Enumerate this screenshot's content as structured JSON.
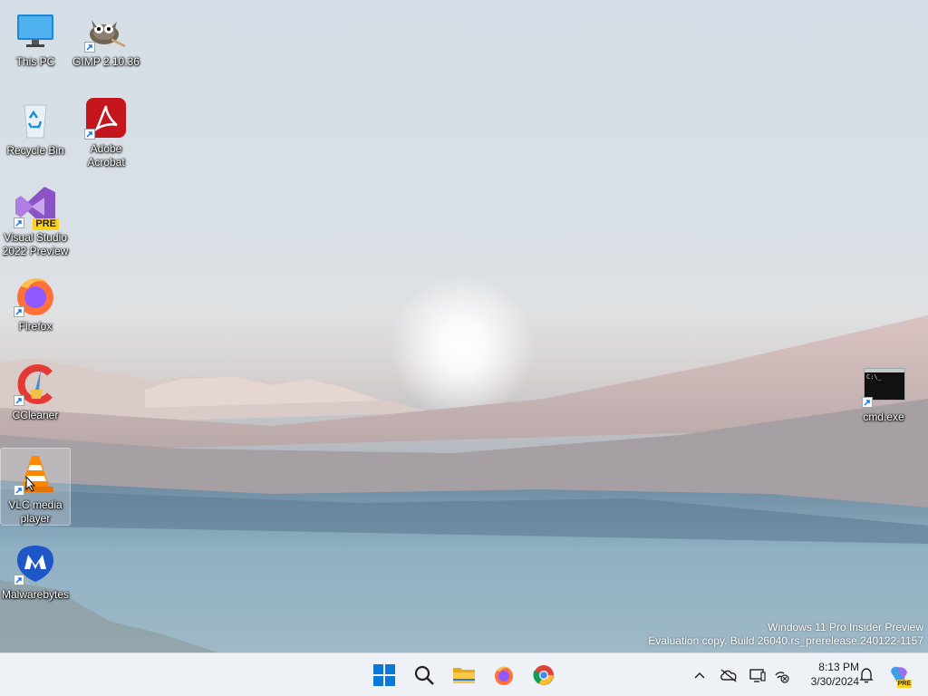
{
  "desktop_icons": [
    {
      "name": "this-pc",
      "label": "This PC",
      "icon": "monitor-icon"
    },
    {
      "name": "gimp",
      "label": "GIMP 2.10.36",
      "icon": "gimp-icon"
    },
    {
      "name": "recycle-bin",
      "label": "Recycle Bin",
      "icon": "recycle-bin-icon"
    },
    {
      "name": "adobe-acrobat",
      "label": "Adobe Acrobat",
      "icon": "acrobat-icon"
    },
    {
      "name": "visual-studio",
      "label": "Visual Studio 2022 Preview",
      "icon": "visual-studio-icon",
      "badge": "PRE"
    },
    {
      "name": "firefox",
      "label": "Firefox",
      "icon": "firefox-icon"
    },
    {
      "name": "ccleaner",
      "label": "CCleaner",
      "icon": "ccleaner-icon"
    },
    {
      "name": "vlc",
      "label": "VLC media player",
      "icon": "vlc-cone-icon",
      "selected": true
    },
    {
      "name": "malwarebytes",
      "label": "Malwarebytes",
      "icon": "malwarebytes-icon"
    },
    {
      "name": "cmd",
      "label": "cmd.exe",
      "icon": "terminal-icon",
      "icon_text": "C:\\_"
    }
  ],
  "watermark": {
    "line1": "Windows 11 Pro Insider Preview",
    "line2": "Evaluation copy. Build 26040.rs_prerelease.240122-1157"
  },
  "taskbar": {
    "pinned": [
      "windows-start-icon",
      "search-icon",
      "file-explorer-icon",
      "firefox-icon",
      "chrome-icon"
    ],
    "tray": [
      "chevron-up-icon",
      "onedrive-offline-icon",
      "display-icon",
      "network-disconnected-icon",
      "notification-bell-icon",
      "copilot-icon"
    ],
    "copilot_badge": "PRE",
    "time": "8:13 PM",
    "date": "3/30/2024"
  },
  "colors": {
    "taskbar_bg": "#eef1f5",
    "start_blue": "#0a78d7",
    "acrobat_red": "#c4161c",
    "vs_purple": "#8b52c6"
  }
}
